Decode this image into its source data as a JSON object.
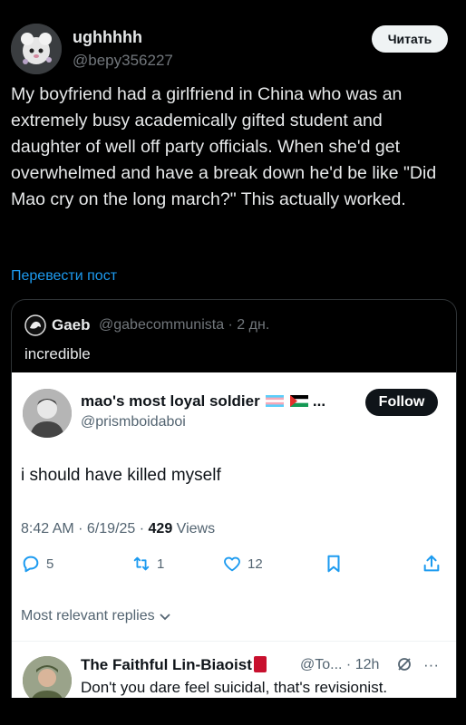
{
  "post": {
    "display_name": "ughhhhh",
    "handle": "@bepy356227",
    "follow_label": "Читать",
    "text": "My boyfriend had a girlfriend in China who was an extremely busy academically gifted student and daughter of well off party officials.  When she'd get overwhelmed and have a break down he'd be like \"Did Mao cry on the long march?\" This actually worked.",
    "translate_label": "Перевести пост"
  },
  "quote": {
    "name": "Gaeb",
    "meta": "@gabecommunista · 2 дн.",
    "text": "incredible"
  },
  "screenshot": {
    "name": "mao's most loyal soldier",
    "name_suffix": " ...",
    "handle": "@prismboidaboi",
    "follow_label": "Follow",
    "text": "i should have killed myself",
    "time": "8:42 AM · 6/19/25 · ",
    "views_count": "429",
    "views_label": " Views",
    "replies": "5",
    "reposts": "1",
    "likes": "12",
    "relevant_label": "Most relevant replies",
    "reply": {
      "name": "The Faithful Lin-Biaoist",
      "meta": "@To... · 12h",
      "text": "Don't you dare feel suicidal, that's revisionist."
    }
  },
  "colors": {
    "accent": "#1d9bf0",
    "background": "#000000",
    "card_light": "#ffffff",
    "book_red": "#c8102e"
  }
}
